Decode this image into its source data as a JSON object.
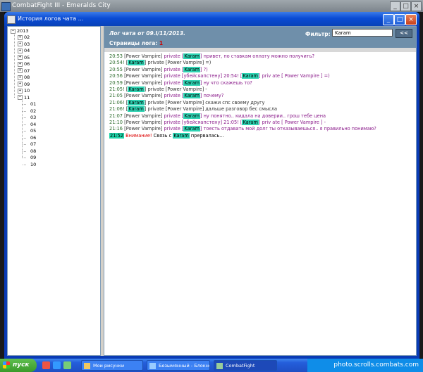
{
  "outer_title": "CombatFight III - Emeralds City",
  "window_title": "История логов чата ...",
  "tree": {
    "year": "2013",
    "months": [
      "02",
      "03",
      "04",
      "05",
      "06",
      "07",
      "08",
      "09",
      "10",
      "11"
    ],
    "days": [
      "01",
      "02",
      "03",
      "04",
      "05",
      "06",
      "07",
      "08",
      "09",
      "10"
    ]
  },
  "log": {
    "title": "Лог чата от 09.I/11/2013.",
    "filter_label": "Фильтр:",
    "filter_value": "Karam",
    "filter_button": "<<",
    "pages_label": "Страницы лога:",
    "pages_value": "1"
  },
  "messages": [
    {
      "time": "20:53",
      "parts": [
        [
          "pv",
          "[Power Vampire] "
        ],
        [
          "pr",
          "private ["
        ],
        [
          "nk",
          "Karam"
        ],
        [
          "pr",
          "] "
        ],
        [
          "tx",
          "привет, по ставкам оплату можно получить?"
        ]
      ]
    },
    {
      "time": "20:54!",
      "parts": [
        [
          "pv",
          "["
        ],
        [
          "nk",
          "Karam"
        ],
        [
          "pv",
          "] private [Power Vampire] =)"
        ]
      ]
    },
    {
      "time": "20:55",
      "parts": [
        [
          "pv",
          "[Power Vampire] "
        ],
        [
          "pr",
          "private ["
        ],
        [
          "nk",
          "Karam"
        ],
        [
          "pr",
          "] ?)"
        ]
      ]
    },
    {
      "time": "20:56",
      "parts": [
        [
          "pv",
          "[Power Vampire] "
        ],
        [
          "pr",
          "private [убейсяапстену] 20:54! ["
        ],
        [
          "nk",
          "Karam"
        ],
        [
          "pr",
          "] priv ate [ Power Vampire ] =)"
        ]
      ]
    },
    {
      "time": "20:59",
      "parts": [
        [
          "pv",
          "[Power Vampire] "
        ],
        [
          "pr",
          "private ["
        ],
        [
          "nk",
          "Karam"
        ],
        [
          "pr",
          "] ну что скажешь то?"
        ]
      ]
    },
    {
      "time": "21:05!",
      "parts": [
        [
          "pv",
          "["
        ],
        [
          "nk",
          "Karam"
        ],
        [
          "pv",
          "] private [Power Vampire] -"
        ]
      ]
    },
    {
      "time": "21:05",
      "parts": [
        [
          "pv",
          "[Power Vampire] "
        ],
        [
          "pr",
          "private ["
        ],
        [
          "nk",
          "Karam"
        ],
        [
          "pr",
          "] почему?"
        ]
      ]
    },
    {
      "time": "21:06!",
      "parts": [
        [
          "pv",
          "["
        ],
        [
          "nk",
          "Karam"
        ],
        [
          "pv",
          "] private [Power Vampire] скажи спс своему другу"
        ]
      ]
    },
    {
      "time": "21:06!",
      "parts": [
        [
          "pv",
          "["
        ],
        [
          "nk",
          "Karam"
        ],
        [
          "pv",
          "] private [Power Vampire] дальше разговор бес смысла"
        ]
      ]
    },
    {
      "time": "21:07",
      "parts": [
        [
          "pv",
          "[Power Vampire] "
        ],
        [
          "pr",
          "private ["
        ],
        [
          "nk",
          "Karam"
        ],
        [
          "pr",
          "] ну понятно.. кидала на доверии.. грош тебе цена"
        ]
      ]
    },
    {
      "time": "21:10",
      "parts": [
        [
          "pv",
          "[Power Vampire] "
        ],
        [
          "pr",
          "private [убейсяапстену] 21:05! ["
        ],
        [
          "nk",
          "Karam"
        ],
        [
          "pr",
          "] priv ate [ Power Vampire ] -"
        ]
      ]
    },
    {
      "time": "21:16",
      "parts": [
        [
          "pv",
          "[Power Vampire] "
        ],
        [
          "pr",
          "private ["
        ],
        [
          "nk",
          "Karam"
        ],
        [
          "pr",
          "] тоесть отдавать мой долг ты отказываешься.. я правильно понимаю?"
        ]
      ]
    }
  ],
  "system_message": {
    "time": "21:52",
    "warn": "Внимание!",
    "before": " Связь с ",
    "nick": "Karam",
    "after": " прервалась..."
  },
  "taskbar": {
    "start_label": "пуск",
    "tasks": [
      "Мои рисунки",
      "Безымянный - Блокнот",
      "CombatFight"
    ],
    "tray_text": "photo.scrolls.combats.com"
  },
  "window_buttons": {
    "minimize": "_",
    "maximize": "□",
    "close": "×"
  },
  "colors": {
    "title_bar": "#0a4bd4",
    "log_header": "#6f8faa",
    "nick_highlight": "#2ed3b3",
    "private_text": "#8a1a8a",
    "warning": "#dd0000"
  }
}
